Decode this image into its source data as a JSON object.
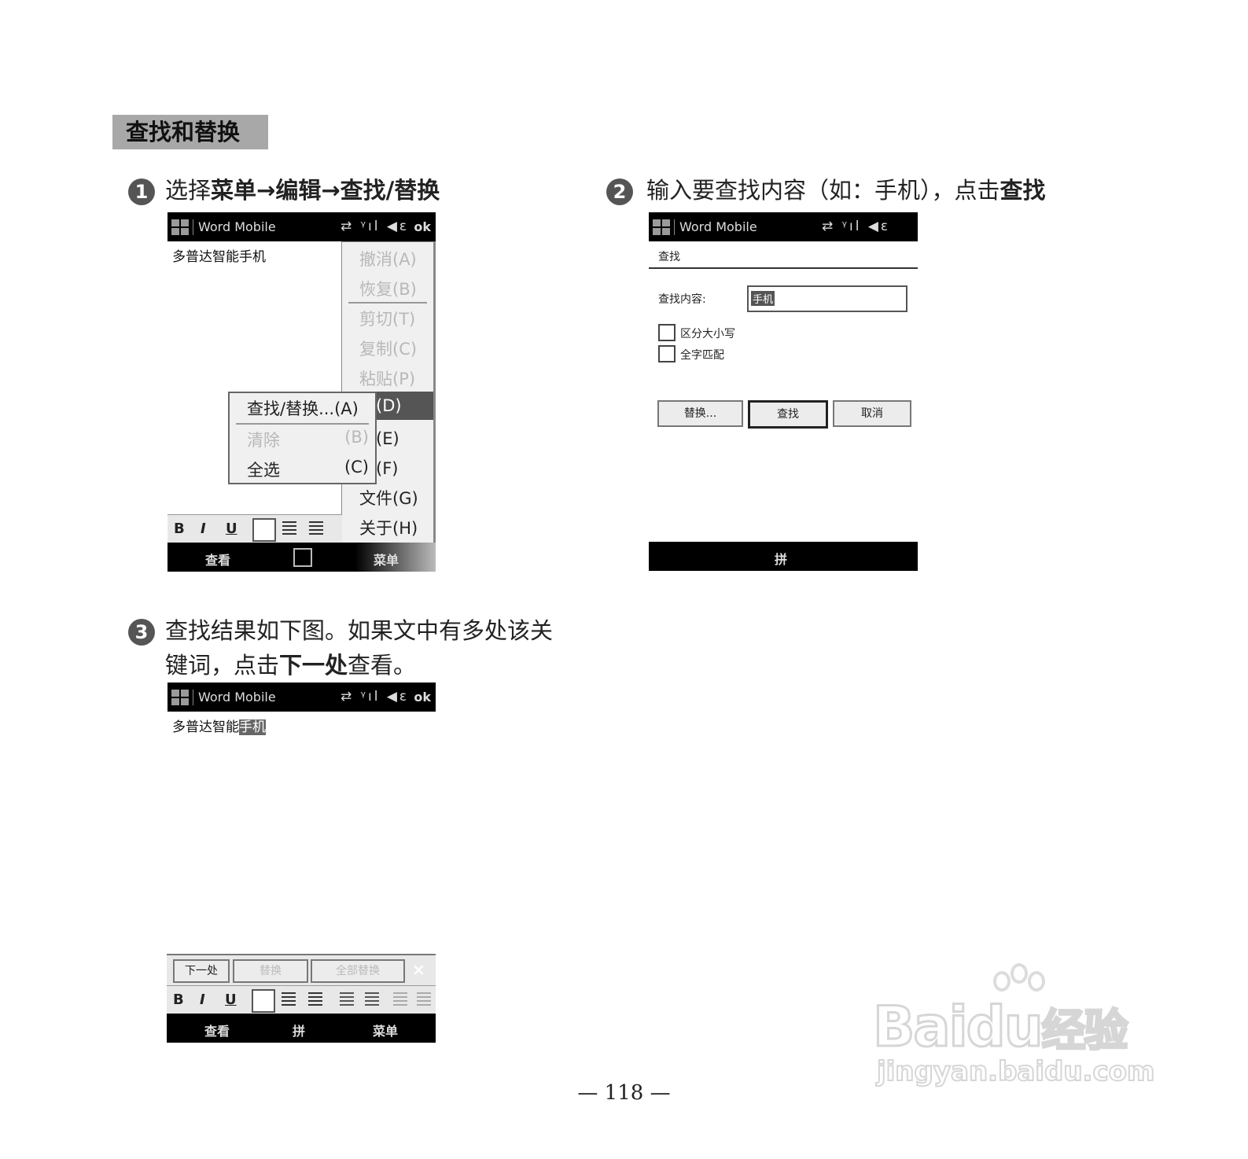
{
  "section": {
    "title": "查找和替换"
  },
  "steps": {
    "s1": {
      "num": "1",
      "prefix": "选择",
      "b1": "菜单",
      "arr1": "→",
      "b2": "编辑",
      "arr2": "→",
      "b3": "查找/替换"
    },
    "s2": {
      "num": "2",
      "prefix": "输入要查找内容（如：手机），点击",
      "b1": "查找"
    },
    "s3": {
      "num": "3",
      "line1": "查找结果如下图。如果文中有多处该关",
      "line2_prefix": "键词，点击",
      "line2_bold": "下一处",
      "line2_suffix": "查看。"
    }
  },
  "screen1": {
    "app_title": "Word Mobile",
    "status_icons": "⇄ ᵞıl ◀ε",
    "ok": "ok",
    "doc_text": "多普达智能手机",
    "main_menu": [
      "撤消(A)",
      "恢复(B)",
      "剪切(T)",
      "复制(C)",
      "粘贴(P)",
      "辑(D)",
      "式(E)",
      "具(F)",
      "文件(G)",
      "关于(H)"
    ],
    "sub_menu": {
      "find": "查找/替换...(A)",
      "clear": "清除",
      "clear_key": "(B)",
      "select_all": "全选",
      "select_all_key": "(C)"
    },
    "fmt": {
      "bold": "B",
      "italic": "I",
      "underline": "U"
    },
    "soft_left": "查看",
    "soft_right": "菜单"
  },
  "screen2": {
    "app_title": "Word Mobile",
    "status_icons": "⇄ ᵞıl ◀ε",
    "heading": "查找",
    "find_label": "查找内容:",
    "find_value": "手机",
    "opt_case": "区分大小写",
    "opt_whole": "全字匹配",
    "btn_replace": "替换...",
    "btn_find": "查找",
    "btn_cancel": "取消",
    "soft_center": "拼"
  },
  "screen3": {
    "app_title": "Word Mobile",
    "status_icons": "⇄ ᵞıl ◀ε",
    "ok": "ok",
    "doc_text": "多普达智能",
    "doc_highlight": "手机",
    "btn_next": "下一处",
    "btn_replace": "替换",
    "btn_replace_all": "全部替换",
    "close": "×",
    "fmt": {
      "bold": "B",
      "italic": "I",
      "underline": "U"
    },
    "soft_left": "查看",
    "soft_center": "拼",
    "soft_right": "菜单"
  },
  "page_number": "— 118 —",
  "watermark": {
    "brand": "Bai",
    "brand2": "du",
    "brand3": "经验",
    "url": "jingyan.baidu.com"
  },
  "colors": {
    "section_bg": "#a8a8a8",
    "bar": "#000000",
    "menu_selected": "#555555"
  }
}
